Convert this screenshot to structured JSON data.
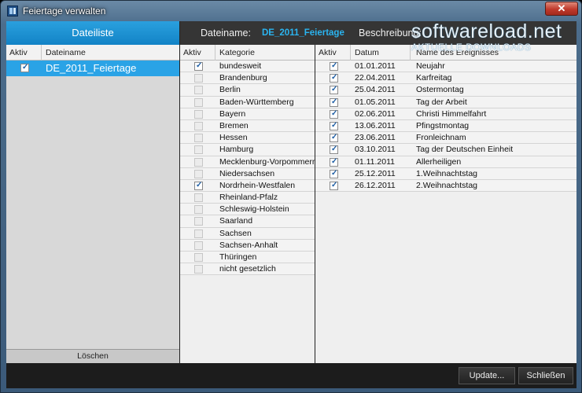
{
  "window": {
    "title": "Feiertage verwalten",
    "close_label": "✕"
  },
  "left": {
    "header": "Dateiliste",
    "col_active": "Aktiv",
    "col_filename": "Dateiname",
    "files": [
      {
        "name": "DE_2011_Feiertage",
        "active": true
      }
    ],
    "delete_label": "Löschen"
  },
  "right": {
    "filename_label": "Dateiname:",
    "filename_value": "DE_2011_Feiertage",
    "description_label": "Beschreibung:"
  },
  "categories": {
    "col_active": "Aktiv",
    "col_category": "Kategorie",
    "items": [
      {
        "name": "bundesweit",
        "active": true
      },
      {
        "name": "Brandenburg",
        "active": false
      },
      {
        "name": "Berlin",
        "active": false
      },
      {
        "name": "Baden-Württemberg",
        "active": false
      },
      {
        "name": "Bayern",
        "active": false
      },
      {
        "name": "Bremen",
        "active": false
      },
      {
        "name": "Hessen",
        "active": false
      },
      {
        "name": "Hamburg",
        "active": false
      },
      {
        "name": "Mecklenburg-Vorpommern",
        "active": false
      },
      {
        "name": "Niedersachsen",
        "active": false
      },
      {
        "name": "Nordrhein-Westfalen",
        "active": true
      },
      {
        "name": "Rheinland-Pfalz",
        "active": false
      },
      {
        "name": "Schleswig-Holstein",
        "active": false
      },
      {
        "name": "Saarland",
        "active": false
      },
      {
        "name": "Sachsen",
        "active": false
      },
      {
        "name": "Sachsen-Anhalt",
        "active": false
      },
      {
        "name": "Thüringen",
        "active": false
      },
      {
        "name": "nicht gesetzlich",
        "active": false
      }
    ]
  },
  "events": {
    "col_active": "Aktiv",
    "col_date": "Datum",
    "col_name": "Name des Ereignisses",
    "items": [
      {
        "date": "01.01.2011",
        "name": "Neujahr",
        "active": true
      },
      {
        "date": "22.04.2011",
        "name": "Karfreitag",
        "active": true
      },
      {
        "date": "25.04.2011",
        "name": "Ostermontag",
        "active": true
      },
      {
        "date": "01.05.2011",
        "name": "Tag der Arbeit",
        "active": true
      },
      {
        "date": "02.06.2011",
        "name": "Christi Himmelfahrt",
        "active": true
      },
      {
        "date": "13.06.2011",
        "name": "Pfingstmontag",
        "active": true
      },
      {
        "date": "23.06.2011",
        "name": "Fronleichnam",
        "active": true
      },
      {
        "date": "03.10.2011",
        "name": "Tag der Deutschen Einheit",
        "active": true
      },
      {
        "date": "01.11.2011",
        "name": "Allerheiligen",
        "active": true
      },
      {
        "date": "25.12.2011",
        "name": "1.Weihnachtstag",
        "active": true
      },
      {
        "date": "26.12.2011",
        "name": "2.Weihnachtstag",
        "active": true
      }
    ]
  },
  "footer": {
    "update_label": "Update...",
    "close_label": "Schließen"
  },
  "watermark": {
    "main": "softwareload.net",
    "sub": "AKTUELLE DOWNLOADS"
  }
}
